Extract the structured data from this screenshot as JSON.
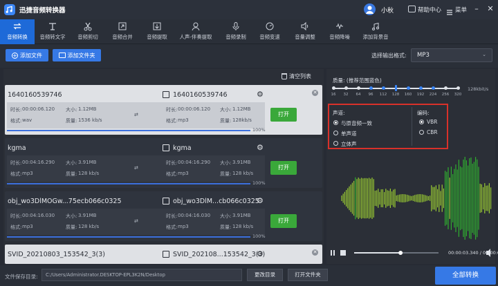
{
  "app": {
    "title": "迅捷音频转换器",
    "username": "小秋",
    "help": "帮助中心",
    "menu": "菜单"
  },
  "toolbar": [
    {
      "label": "音频转换",
      "icon": "convert-icon"
    },
    {
      "label": "音频转文字",
      "icon": "audio-to-text-icon"
    },
    {
      "label": "音频剪切",
      "icon": "scissors-icon"
    },
    {
      "label": "音频合并",
      "icon": "merge-icon"
    },
    {
      "label": "音频提取",
      "icon": "extract-icon"
    },
    {
      "label": "人声-伴奏提取",
      "icon": "vocal-icon"
    },
    {
      "label": "音频录制",
      "icon": "microphone-icon"
    },
    {
      "label": "音频变速",
      "icon": "speed-icon"
    },
    {
      "label": "音量调整",
      "icon": "volume-icon"
    },
    {
      "label": "音频降噪",
      "icon": "denoise-icon"
    },
    {
      "label": "添加背景音",
      "icon": "background-music-icon"
    }
  ],
  "actions": {
    "add_file": "添加文件",
    "add_folder": "添加文件夹",
    "format_label": "选择输出格式:",
    "format_value": "MP3",
    "clear_list": "清空列表"
  },
  "files": [
    {
      "name": "1640160539746",
      "out_name": "1640160539746",
      "duration_label": "时长:",
      "duration": "00:00:06.120",
      "size_label": "大小:",
      "size": "1.12MB",
      "format_label": "格式:",
      "format": "wav",
      "quality_label": "质量:",
      "quality": "1536 kb/s",
      "out_duration": "00:00:06.120",
      "out_size": "1.12MB",
      "out_format": "mp3",
      "out_quality": "128kb/s",
      "open": "打开",
      "progress": "100%",
      "progress_value": 1.0
    },
    {
      "name": "kgma",
      "out_name": "kgma",
      "duration_label": "时长:",
      "duration": "00:04:16.290",
      "size_label": "大小:",
      "size": "3.91MB",
      "format_label": "格式:",
      "format": "mp3",
      "quality_label": "质量:",
      "quality": "128 kb/s",
      "out_duration": "00:04:16.290",
      "out_size": "3.91MB",
      "out_format": "mp3",
      "out_quality": "128 kb/s",
      "open": "打开",
      "progress": "100%",
      "progress_value": 1.0
    },
    {
      "name": "obj_wo3DlMOGw...75ecb066c0325",
      "out_name": "obj_wo3DlM...cb066c0325",
      "duration_label": "时长:",
      "duration": "00:04:16.030",
      "size_label": "大小:",
      "size": "3.91MB",
      "format_label": "格式:",
      "format": "mp3",
      "quality_label": "质量:",
      "quality": "128 kb/s",
      "out_duration": "00:04:16.030",
      "out_size": "3.91MB",
      "out_format": "mp3",
      "out_quality": "128 kb/s",
      "open": "打开",
      "progress": "100%",
      "progress_value": 1.0
    },
    {
      "name": "SVID_20210803_153542_3(3)",
      "out_name": "SVID_202108...153542_3(3)"
    }
  ],
  "settings": {
    "quality_label": "质量: (推荐范围蓝色)",
    "bitrates": [
      "16",
      "32",
      "64",
      "96",
      "112",
      "128",
      "160",
      "192",
      "224",
      "256",
      "320"
    ],
    "selected_bitrate": "128",
    "unit": "128kbit/s",
    "channel_label": "声道:",
    "channel_options": [
      "与原音频一致",
      "单声道",
      "立体声"
    ],
    "channel_selected": 0,
    "encoding_label": "编码:",
    "encoding_options": [
      "VBR",
      "CBR"
    ],
    "encoding_selected": 0
  },
  "player": {
    "time": "00:00:03.340 / 00:00:06.120",
    "position": 0.55
  },
  "bottom": {
    "save_label": "文件保存目录:",
    "save_path": "C:/Users/Administrator.DESKTOP-EPL3K2N/Desktop",
    "change_dir": "更改目录",
    "open_folder": "打开文件夹",
    "convert_all": "全部转换"
  }
}
